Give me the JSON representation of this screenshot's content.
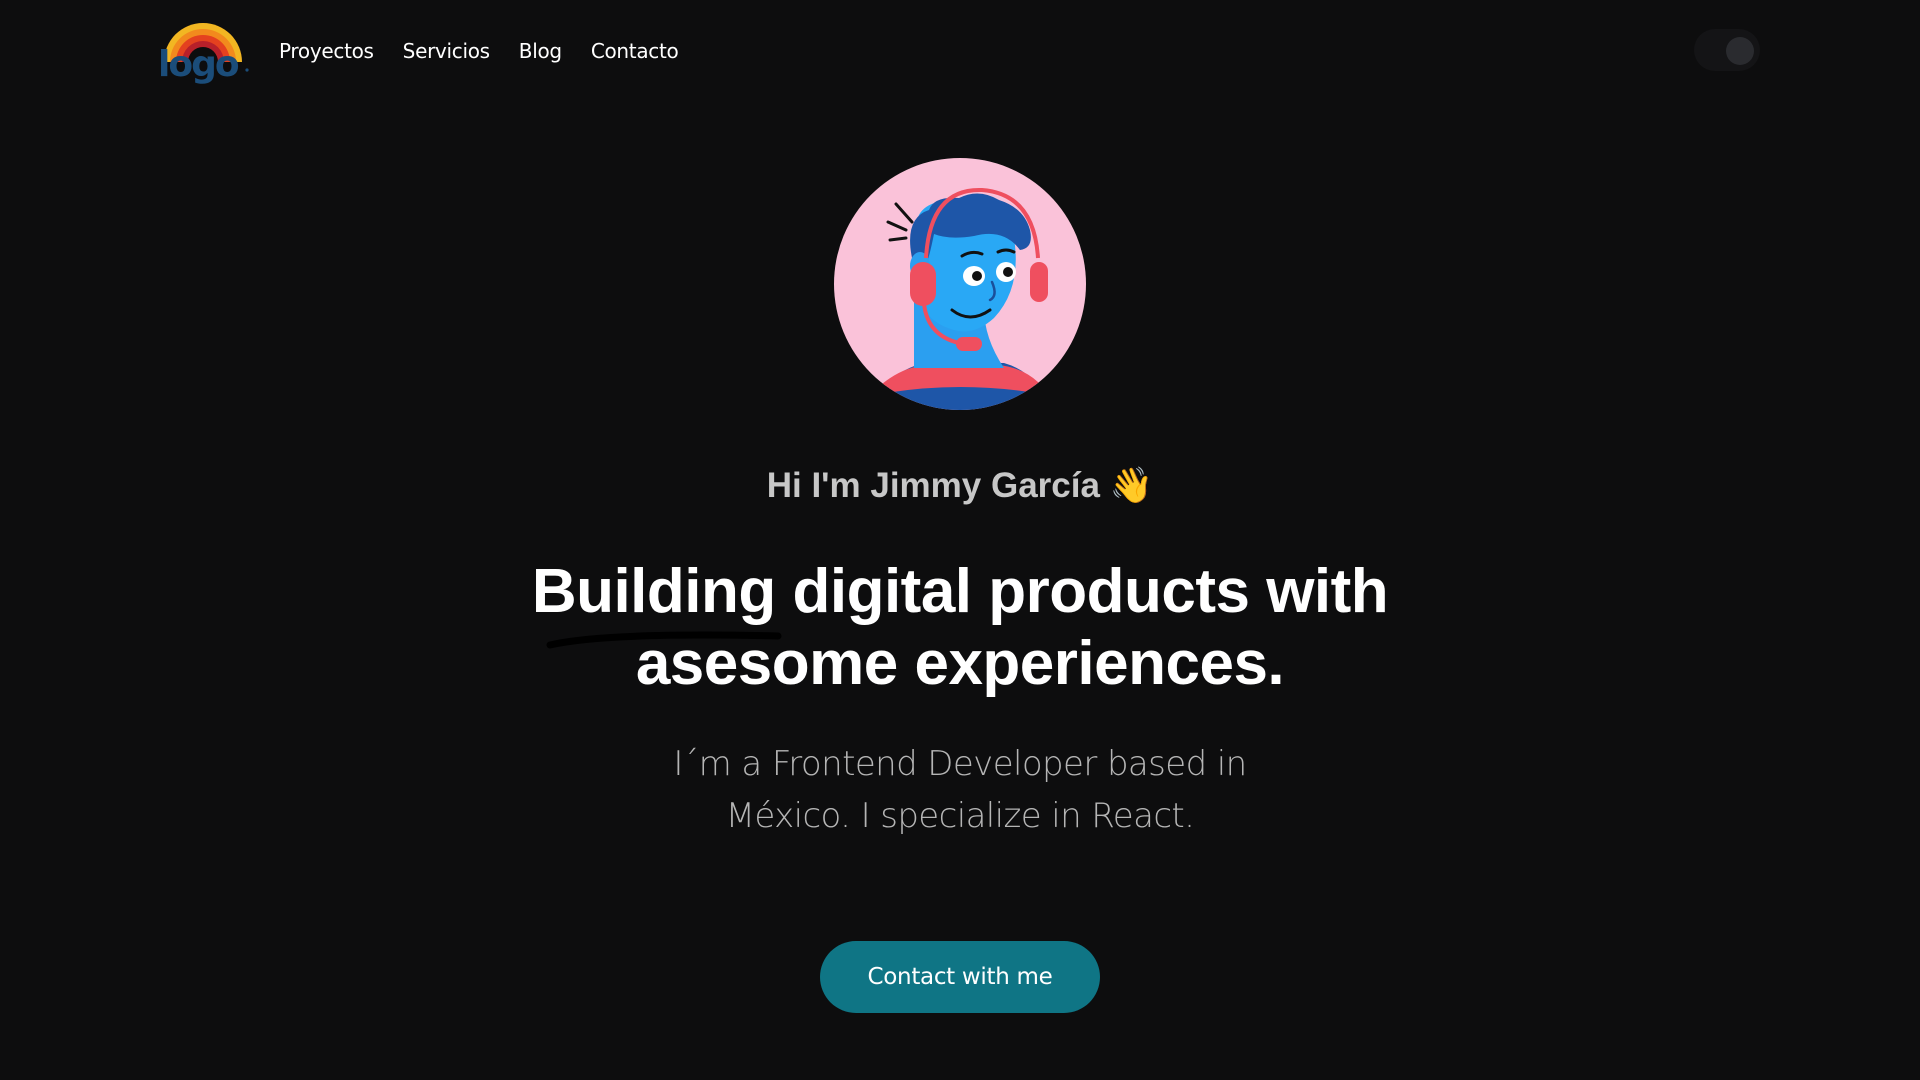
{
  "header": {
    "logo": {
      "text": "logo"
    },
    "nav": [
      {
        "label": "Proyectos"
      },
      {
        "label": "Servicios"
      },
      {
        "label": "Blog"
      },
      {
        "label": "Contacto"
      }
    ],
    "theme_toggle": {
      "state": "dark",
      "icon": "toggle-switch-icon"
    }
  },
  "hero": {
    "avatar": {
      "icon": "developer-avatar-illustration"
    },
    "greeting": "Hi I'm Jimmy García",
    "greeting_emoji": "👋",
    "headline_line1": "Building digital products with",
    "headline_line2": "asesome experiences.",
    "subtitle_line1": "I´m a Frontend Developer based in",
    "subtitle_line2": "México. I specialize in React.",
    "cta_label": "Contact with me"
  },
  "colors": {
    "background": "#0d0d0e",
    "accent": "#0f7585",
    "greeting_text": "#c7c7c7",
    "subtitle_text": "#b5b5b5"
  }
}
